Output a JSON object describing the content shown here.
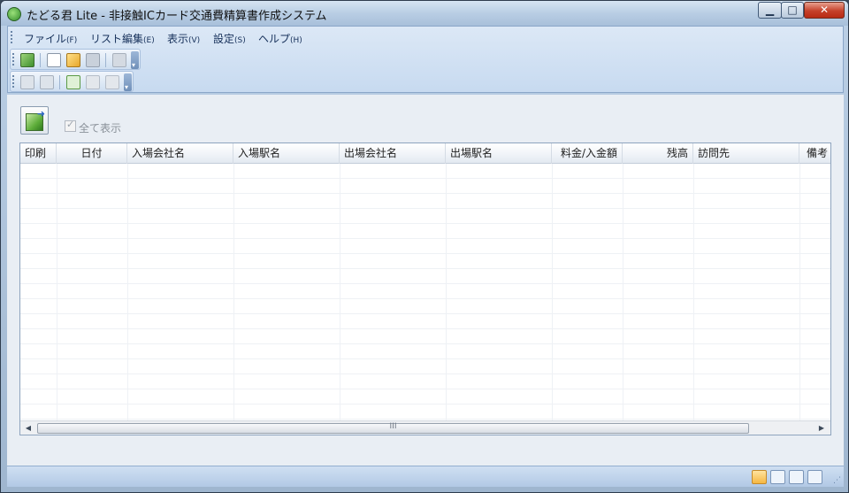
{
  "window": {
    "title": "たどる君  Lite - 非接触ICカード交通費精算書作成システム",
    "minimize_glyph": "▁",
    "maximize_glyph": "□",
    "close_glyph": "✕"
  },
  "menu": [
    {
      "label": "ファイル",
      "accel": "(F)"
    },
    {
      "label": "リスト編集",
      "accel": "(E)"
    },
    {
      "label": "表示",
      "accel": "(V)"
    },
    {
      "label": "設定",
      "accel": "(S)"
    },
    {
      "label": "ヘルプ",
      "accel": "(H)"
    }
  ],
  "toolbar1": [
    "import-icon",
    "new-document-icon",
    "open-folder-icon",
    "save-icon",
    "print-icon"
  ],
  "toolbar2": [
    "move-up-icon",
    "move-down-icon",
    "add-row-icon",
    "edit-row-icon",
    "delete-row-icon"
  ],
  "content": {
    "show_all_label": "全て表示",
    "show_all_checked": true,
    "check_glyph": "✓"
  },
  "grid": {
    "columns": [
      "印刷",
      "日付",
      "入場会社名",
      "入場駅名",
      "出場会社名",
      "出場駅名",
      "料金/入金額",
      "残高",
      "訪問先",
      "備考"
    ],
    "rows": []
  },
  "scroll": {
    "left_arrow": "◀",
    "right_arrow": "▶",
    "thumb_grip": "III"
  },
  "statusbar": {
    "icons": [
      "grid-view-icon",
      "list-view-icon",
      "export-icon",
      "report-icon"
    ],
    "resize_grip": "⋰"
  },
  "colors": {
    "accent": "#c7daf0",
    "close_button": "#c5402a"
  }
}
